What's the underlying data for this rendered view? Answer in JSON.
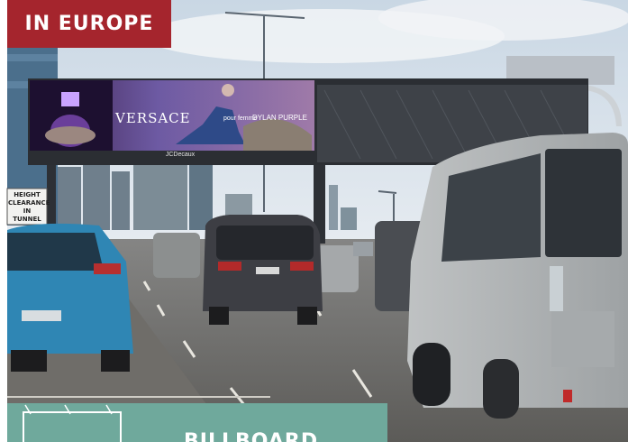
{
  "tag_label": "IN EUROPE",
  "billboard": {
    "brand": "VERSACE",
    "sub_text": "pour femme",
    "product": "DYLAN PURPLE",
    "operator": "JCDecaux"
  },
  "road_sign": "HEIGHT CLEARANCE IN TUNNEL",
  "panel_title": "BILLBOARD",
  "colors": {
    "tag": "#a5252d",
    "panel": "#6fa99c"
  }
}
